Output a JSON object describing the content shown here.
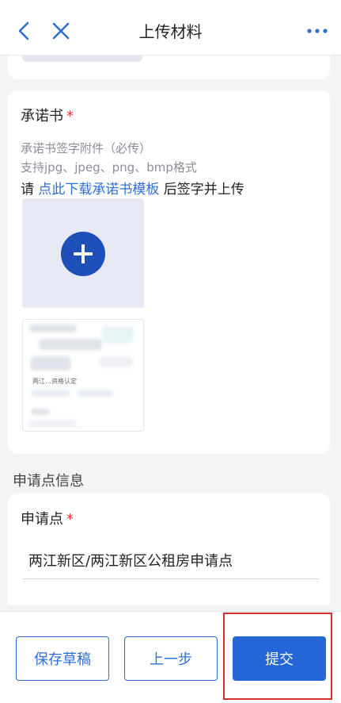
{
  "header": {
    "title": "上传材料"
  },
  "commitment": {
    "label": "承诺书",
    "required_mark": "*",
    "hint_required": "承诺书签字附件（必传）",
    "hint_formats": "支持jpg、jpeg、png、bmp格式",
    "download_prefix": "请 ",
    "download_link": "点此下载承诺书模板",
    "download_suffix": " 后签字并上传"
  },
  "thumbnail": {
    "text_1": "两江…资格认定"
  },
  "section": {
    "title": "申请点信息"
  },
  "application_point": {
    "label": "申请点",
    "required_mark": "*",
    "value": "两江新区/两江新区公租房申请点"
  },
  "footer": {
    "save_draft": "保存草稿",
    "previous": "上一步",
    "submit": "提交"
  },
  "colors": {
    "accent": "#2466d6",
    "required": "#e53935",
    "highlight": "#d32f2f"
  }
}
